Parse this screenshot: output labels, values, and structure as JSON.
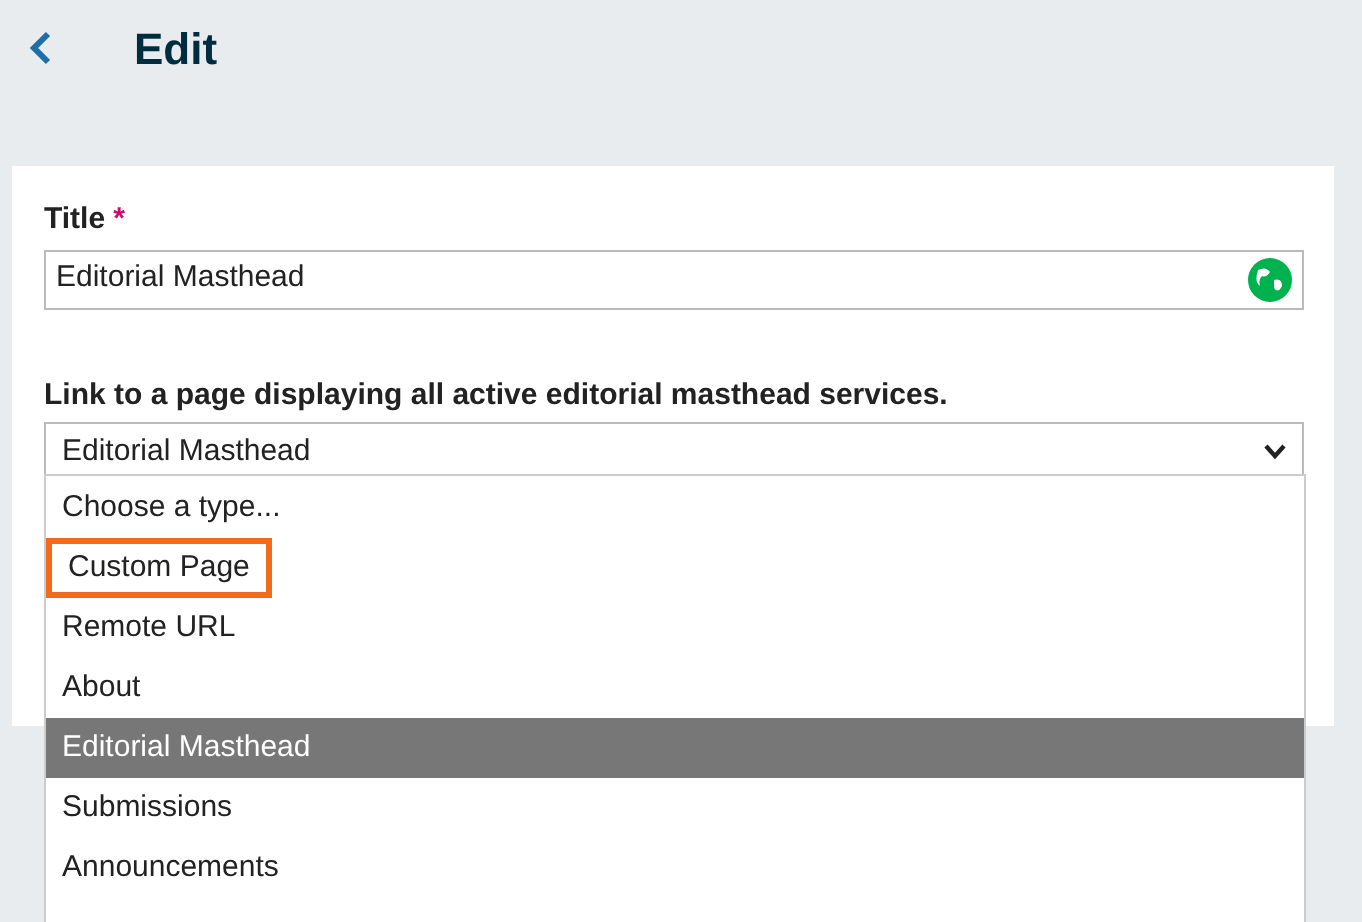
{
  "header": {
    "title": "Edit"
  },
  "title_field": {
    "label": "Title",
    "required_mark": "*",
    "value": "Editorial Masthead"
  },
  "link_field": {
    "label": "Link to a page displaying all active editorial masthead services.",
    "value": "Editorial Masthead"
  },
  "dropdown": {
    "options": [
      {
        "label": "Choose a type...",
        "selected": false,
        "outlined": false
      },
      {
        "label": "Custom Page",
        "selected": false,
        "outlined": true
      },
      {
        "label": "Remote URL",
        "selected": false,
        "outlined": false
      },
      {
        "label": "About",
        "selected": false,
        "outlined": false
      },
      {
        "label": "Editorial Masthead",
        "selected": true,
        "outlined": false
      },
      {
        "label": "Submissions",
        "selected": false,
        "outlined": false
      },
      {
        "label": "Announcements",
        "selected": false,
        "outlined": false
      }
    ]
  }
}
